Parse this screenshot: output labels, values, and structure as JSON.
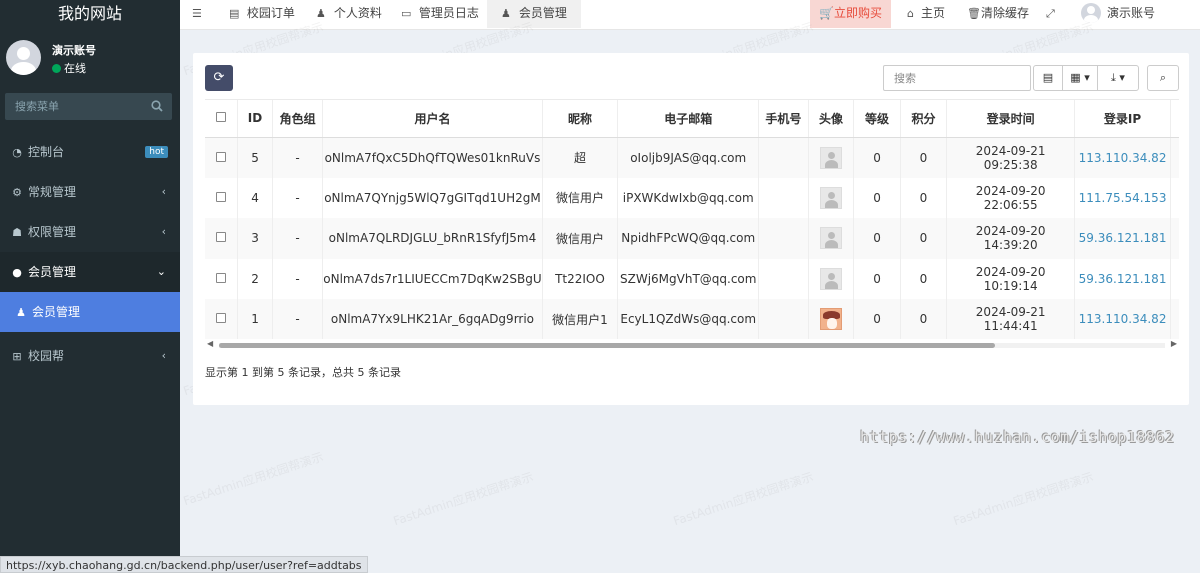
{
  "site": {
    "logo": "我的网站"
  },
  "user": {
    "name": "演示账号",
    "status": "在线"
  },
  "sidebar": {
    "search_placeholder": "搜索菜单",
    "items": [
      {
        "label": "控制台",
        "icon": "dashboard-icon",
        "badge": "hot"
      },
      {
        "label": "常规管理",
        "icon": "cogs-icon"
      },
      {
        "label": "权限管理",
        "icon": "group-icon"
      },
      {
        "label": "会员管理",
        "icon": "user-circle-icon"
      },
      {
        "label": "会员管理",
        "icon": "user-icon"
      },
      {
        "label": "校园帮",
        "icon": "sitemap-icon"
      }
    ]
  },
  "topnav": {
    "menu_icon": "bars-icon",
    "tabs": [
      {
        "label": "校园订单",
        "icon": "list-icon"
      },
      {
        "label": "个人资料",
        "icon": "user-icon"
      },
      {
        "label": "管理员日志",
        "icon": "list-alt-icon"
      },
      {
        "label": "会员管理",
        "icon": "user-icon"
      }
    ],
    "buy_label": "立即购买",
    "home_label": "主页",
    "clear_cache_label": "清除缓存",
    "account_label": "演示账号"
  },
  "toolbar": {
    "search_placeholder": "搜索"
  },
  "table": {
    "headers": [
      "ID",
      "角色组",
      "用户名",
      "昵称",
      "电子邮箱",
      "手机号",
      "头像",
      "等级",
      "积分",
      "登录时间",
      "登录IP"
    ],
    "rows": [
      {
        "id": "5",
        "group": "-",
        "username": "oNlmA7fQxC5DhQfTQWes01knRuVs",
        "nickname": "超",
        "email": "oIoljb9JAS@qq.com",
        "mobile": "",
        "avatar": "default-avatar",
        "level": "0",
        "score": "0",
        "login_time": "2024-09-21 09:25:38",
        "login_ip": "113.110.34.82"
      },
      {
        "id": "4",
        "group": "-",
        "username": "oNlmA7QYnjg5WlQ7gGITqd1UH2gM",
        "nickname": "微信用户",
        "email": "iPXWKdwIxb@qq.com",
        "mobile": "",
        "avatar": "default-avatar",
        "level": "0",
        "score": "0",
        "login_time": "2024-09-20 22:06:55",
        "login_ip": "111.75.54.153"
      },
      {
        "id": "3",
        "group": "-",
        "username": "oNlmA7QLRDJGLU_bRnR1SfyfJ5m4",
        "nickname": "微信用户",
        "email": "NpidhFPcWQ@qq.com",
        "mobile": "",
        "avatar": "default-avatar",
        "level": "0",
        "score": "0",
        "login_time": "2024-09-20 14:39:20",
        "login_ip": "59.36.121.181"
      },
      {
        "id": "2",
        "group": "-",
        "username": "oNlmA7ds7r1LIUECCm7DqKw2SBgU",
        "nickname": "Tt22IOO",
        "email": "SZWj6MgVhT@qq.com",
        "mobile": "",
        "avatar": "default-avatar",
        "level": "0",
        "score": "0",
        "login_time": "2024-09-20 10:19:14",
        "login_ip": "59.36.121.181"
      },
      {
        "id": "1",
        "group": "-",
        "username": "oNlmA7Yx9LHK21Ar_6gqADg9rrio",
        "nickname": "微信用户1",
        "email": "EcyL1QZdWs@qq.com",
        "mobile": "",
        "avatar": "cartoon-avatar",
        "level": "0",
        "score": "0",
        "login_time": "2024-09-21 11:44:41",
        "login_ip": "113.110.34.82"
      }
    ]
  },
  "pagination": {
    "info": "显示第 1 到第 5 条记录，总共 5 条记录"
  },
  "watermark": {
    "url": "https://www.huzhan.com/ishop18862",
    "text": "FastAdmin应用校园帮演示"
  },
  "statusbar": {
    "url": "https://xyb.chaohang.gd.cn/backend.php/user/user?ref=addtabs"
  },
  "colors": {
    "sidebar_bg": "#222d32",
    "active_menu": "#4e7ee0",
    "ip_link": "#3c8dbc",
    "buy_bg": "#f8d7d3",
    "buy_text": "#e74c3c",
    "online": "#00a65a"
  }
}
